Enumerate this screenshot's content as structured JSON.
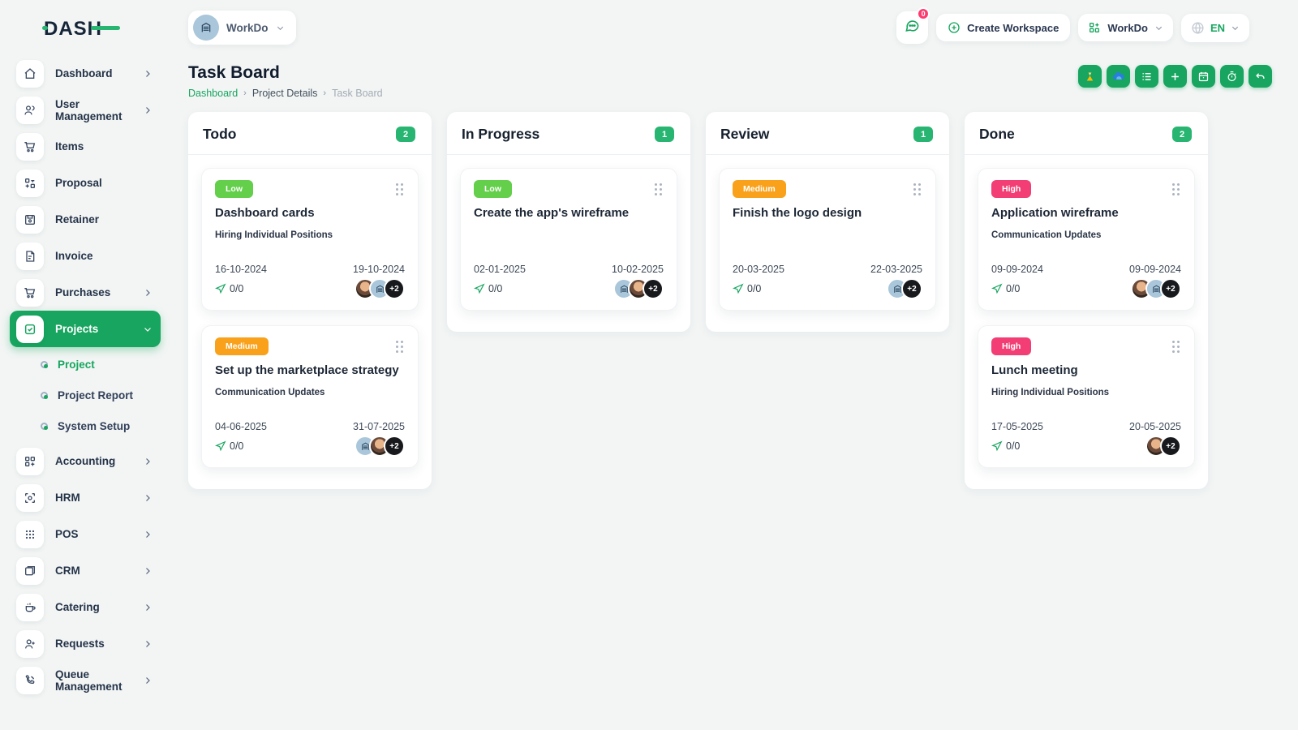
{
  "colors": {
    "primary": "#17a55f",
    "bg": "#f2f5f4",
    "navy": "#1c2a3a",
    "low": "#63cf4a",
    "medium": "#f9a11b",
    "high": "#f23e74"
  },
  "topbar": {
    "workspace_name": "WorkDo",
    "messages_badge": "0",
    "create_workspace_label": "Create Workspace",
    "app_switcher_label": "WorkDo",
    "language": "EN"
  },
  "sidebar": {
    "logo_text": "DASH",
    "items": [
      {
        "label": "Dashboard"
      },
      {
        "label": "User Management"
      },
      {
        "label": "Items"
      },
      {
        "label": "Proposal"
      },
      {
        "label": "Retainer"
      },
      {
        "label": "Invoice"
      },
      {
        "label": "Purchases"
      },
      {
        "label": "Projects"
      },
      {
        "label": "Accounting"
      },
      {
        "label": "HRM"
      },
      {
        "label": "POS"
      },
      {
        "label": "CRM"
      },
      {
        "label": "Catering"
      },
      {
        "label": "Requests"
      },
      {
        "label": "Queue Management"
      }
    ],
    "projects_submenu": [
      {
        "label": "Project"
      },
      {
        "label": "Project Report"
      },
      {
        "label": "System Setup"
      }
    ]
  },
  "page": {
    "title": "Task Board",
    "breadcrumb": {
      "home": "Dashboard",
      "parent": "Project Details",
      "current": "Task Board"
    }
  },
  "board": {
    "columns": [
      {
        "title": "Todo",
        "count": "2",
        "cards": [
          {
            "priority": "Low",
            "priority_color": "#63cf4a",
            "title": "Dashboard cards",
            "milestone": "Hiring Individual Positions",
            "start_date": "16-10-2024",
            "end_date": "19-10-2024",
            "progress": "0/0",
            "more": "+2"
          },
          {
            "priority": "Medium",
            "priority_color": "#f9a11b",
            "title": "Set up the marketplace strategy",
            "milestone": "Communication Updates",
            "start_date": "04-06-2025",
            "end_date": "31-07-2025",
            "progress": "0/0",
            "more": "+2"
          }
        ]
      },
      {
        "title": "In Progress",
        "count": "1",
        "cards": [
          {
            "priority": "Low",
            "priority_color": "#63cf4a",
            "title": "Create the app's wireframe",
            "milestone": "",
            "start_date": "02-01-2025",
            "end_date": "10-02-2025",
            "progress": "0/0",
            "more": "+2"
          }
        ]
      },
      {
        "title": "Review",
        "count": "1",
        "cards": [
          {
            "priority": "Medium",
            "priority_color": "#f9a11b",
            "title": "Finish the logo design",
            "milestone": "",
            "start_date": "20-03-2025",
            "end_date": "22-03-2025",
            "progress": "0/0",
            "more": "+2"
          }
        ]
      },
      {
        "title": "Done",
        "count": "2",
        "cards": [
          {
            "priority": "High",
            "priority_color": "#f23e74",
            "title": "Application wireframe",
            "milestone": "Communication Updates",
            "start_date": "09-09-2024",
            "end_date": "09-09-2024",
            "progress": "0/0",
            "more": "+2"
          },
          {
            "priority": "High",
            "priority_color": "#f23e74",
            "title": "Lunch meeting",
            "milestone": "Hiring Individual Positions",
            "start_date": "17-05-2025",
            "end_date": "20-05-2025",
            "progress": "0/0",
            "more": "+2"
          }
        ]
      }
    ]
  }
}
